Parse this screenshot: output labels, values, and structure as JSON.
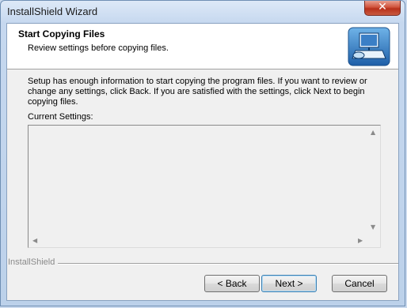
{
  "window": {
    "title": "InstallShield Wizard"
  },
  "header": {
    "title": "Start Copying Files",
    "subtitle": "Review settings before copying files."
  },
  "body": {
    "line1": "Setup has enough information to start copying the program files.  If you want to review or",
    "line2": "change any settings, click Back.  If you are satisfied with the settings, click Next to begin",
    "line3": "copying files.",
    "settings_label": "Current Settings:",
    "settings_text": ""
  },
  "footer": {
    "brand": "InstallShield",
    "back_label": "< Back",
    "next_label": "Next >",
    "cancel_label": "Cancel"
  },
  "icons": {
    "close": "close-icon",
    "header": "computer-install-icon",
    "scroll_up": "scroll-up-arrow",
    "scroll_down": "scroll-down-arrow",
    "scroll_left": "scroll-left-arrow",
    "scroll_right": "scroll-right-arrow"
  }
}
